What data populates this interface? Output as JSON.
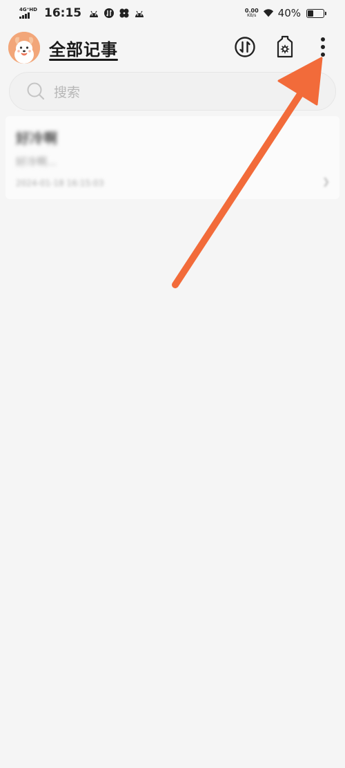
{
  "status_bar": {
    "network": "4G⁺HD",
    "time": "16:15",
    "speed_value": "0.00",
    "speed_unit": "KB/s",
    "battery": "40%",
    "battery_level": 0.4
  },
  "header": {
    "title": "全部记事",
    "sort_icon": "sort-updown-icon",
    "skin_icon": "theme-tag-icon",
    "more_icon": "more-vertical-icon"
  },
  "search": {
    "placeholder": "搜索"
  },
  "notes": [
    {
      "title": "好冷啊",
      "preview": "好冷啊...",
      "date": "2024-01-18 16:15:03"
    }
  ],
  "colors": {
    "background": "#f5f5f5",
    "annotation_arrow": "#f26b3a",
    "avatar": "#f2a679"
  }
}
